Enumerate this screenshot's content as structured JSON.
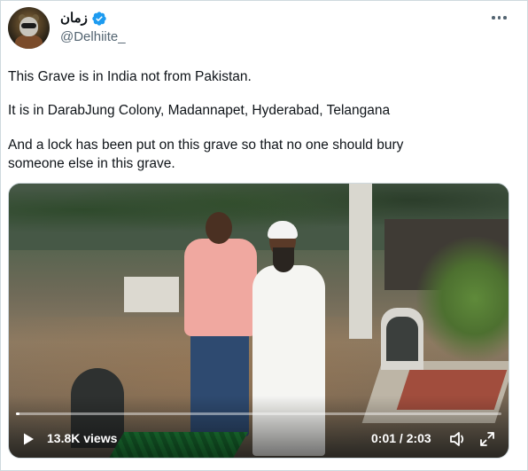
{
  "author": {
    "display_name": "زمان",
    "handle": "@Delhiite_",
    "verified": true
  },
  "tweet": {
    "paragraphs": [
      "This Grave is in India not from Pakistan.",
      "It is in DarabJung Colony, Madannapet, Hyderabad, Telangana",
      "And a lock has been put on this grave so that no one should bury\nsomeone else in this grave."
    ]
  },
  "video": {
    "views": "13.8K views",
    "time": "0:01 / 2:03",
    "progress": 0.008
  },
  "icons": {
    "verified": "verified-badge-icon",
    "more": "more-options-icon",
    "play": "play-icon",
    "volume": "volume-icon",
    "fullscreen": "fullscreen-icon"
  },
  "colors": {
    "accent": "#1d9bf0",
    "text": "#0f1419",
    "secondary": "#536471"
  }
}
